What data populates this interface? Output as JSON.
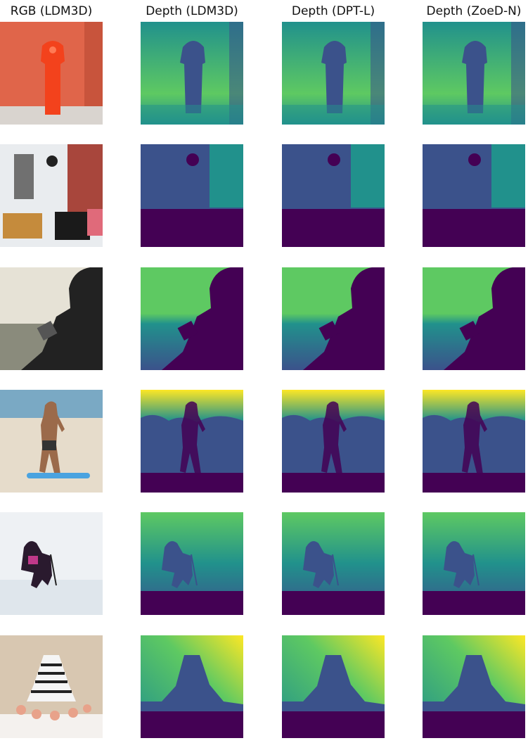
{
  "columns": [
    {
      "title": "RGB (LDM3D)"
    },
    {
      "title": "Depth (LDM3D)"
    },
    {
      "title": "Depth (DPT-L)"
    },
    {
      "title": "Depth (ZoeD-N)"
    }
  ],
  "rows": [
    {
      "scene": "fire-hydrant"
    },
    {
      "scene": "storefront-furniture"
    },
    {
      "scene": "person-reading-by-sea"
    },
    {
      "scene": "beach-skateboarder"
    },
    {
      "scene": "skier"
    },
    {
      "scene": "tiered-cake"
    }
  ],
  "colors": {
    "depth_far": "#440154",
    "depth_mid1": "#3b528b",
    "depth_mid2": "#21918c",
    "depth_mid3": "#5ec962",
    "depth_near": "#fde725"
  }
}
